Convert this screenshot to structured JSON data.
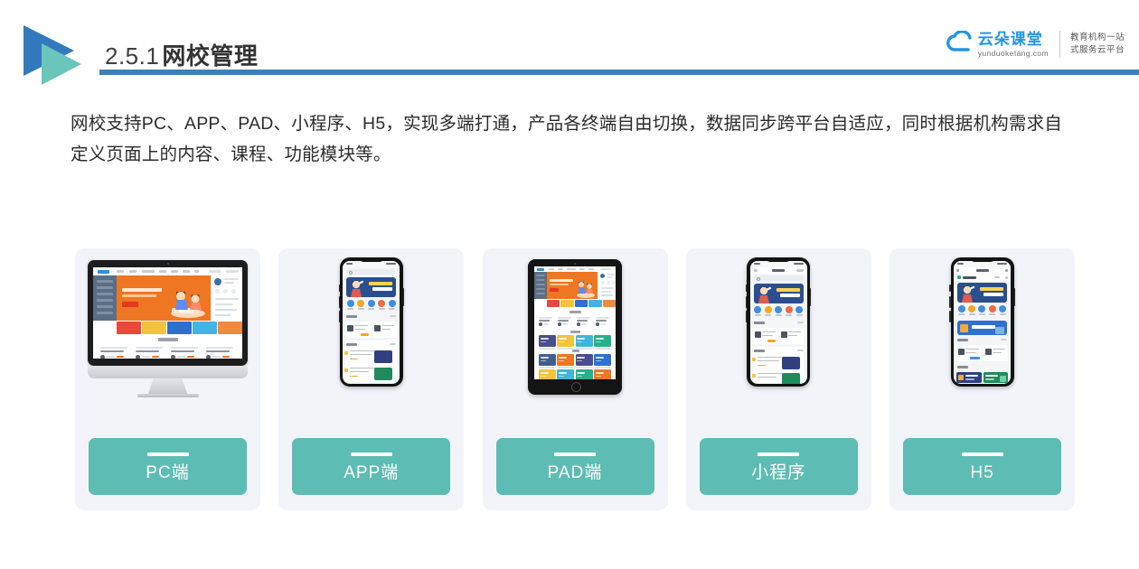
{
  "header": {
    "title_number": "2.5.1",
    "title_text": "网校管理",
    "rule_color": "#3f7fb5",
    "logo_icon": "double-triangle-play-logo",
    "logo_colors": {
      "primary": "#3379bd",
      "secondary": "#6ac5bb"
    }
  },
  "brand": {
    "icon": "cloud-icon",
    "name_cn": "云朵课堂",
    "url": "yunduoketang.com",
    "tagline_line1": "教育机构一站",
    "tagline_line2": "式服务云平台",
    "accent_color": "#2196e3"
  },
  "body": {
    "paragraph": "网校支持PC、APP、PAD、小程序、H5，实现多端打通，产品各终端自由切换，数据同步跨平台自适应，同时根据机构需求自定义页面上的内容、课程、功能模块等。"
  },
  "cards": {
    "label_bg": "#5dbcb3",
    "card_bg": "#f2f4fa",
    "items": [
      {
        "label": "PC端",
        "device": "desktop-monitor",
        "device_icon": "imac-icon"
      },
      {
        "label": "APP端",
        "device": "smartphone",
        "device_icon": "iphone-icon"
      },
      {
        "label": "PAD端",
        "device": "tablet",
        "device_icon": "ipad-icon"
      },
      {
        "label": "小程序",
        "device": "smartphone",
        "device_icon": "iphone-icon"
      },
      {
        "label": "H5",
        "device": "smartphone",
        "device_icon": "iphone-icon"
      }
    ]
  }
}
